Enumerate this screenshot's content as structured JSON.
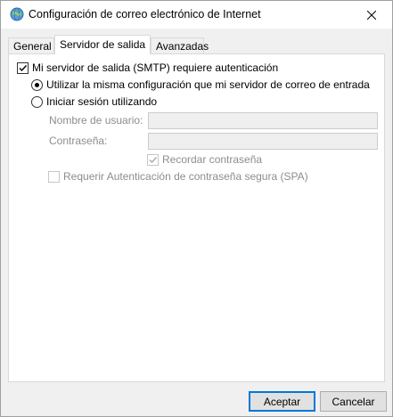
{
  "window": {
    "title": "Configuración de correo electrónico de Internet"
  },
  "tabs": [
    {
      "label": "General",
      "active": false
    },
    {
      "label": "Servidor de salida",
      "active": true
    },
    {
      "label": "Avanzadas",
      "active": false
    }
  ],
  "smtp_auth": {
    "label": "Mi servidor de salida (SMTP) requiere autenticación",
    "checked": true
  },
  "options": {
    "same_settings_label": "Utilizar la misma configuración que mi servidor de correo de entrada",
    "same_settings_selected": true,
    "login_label": "Iniciar sesión utilizando",
    "login_selected": false
  },
  "fields": {
    "username_label": "Nombre de usuario:",
    "username_value": "",
    "password_label": "Contraseña:",
    "password_value": ""
  },
  "remember_password": {
    "label": "Recordar contraseña",
    "checked": true,
    "enabled": false
  },
  "spa": {
    "label": "Requerir Autenticación de contraseña segura (SPA)",
    "checked": false,
    "enabled": false
  },
  "buttons": {
    "accept": "Aceptar",
    "cancel": "Cancelar"
  },
  "icons": {
    "app": "globe-mail-icon",
    "close": "close-icon"
  },
  "colors": {
    "accent": "#0078d7",
    "disabled_text": "#8d8d8d"
  }
}
